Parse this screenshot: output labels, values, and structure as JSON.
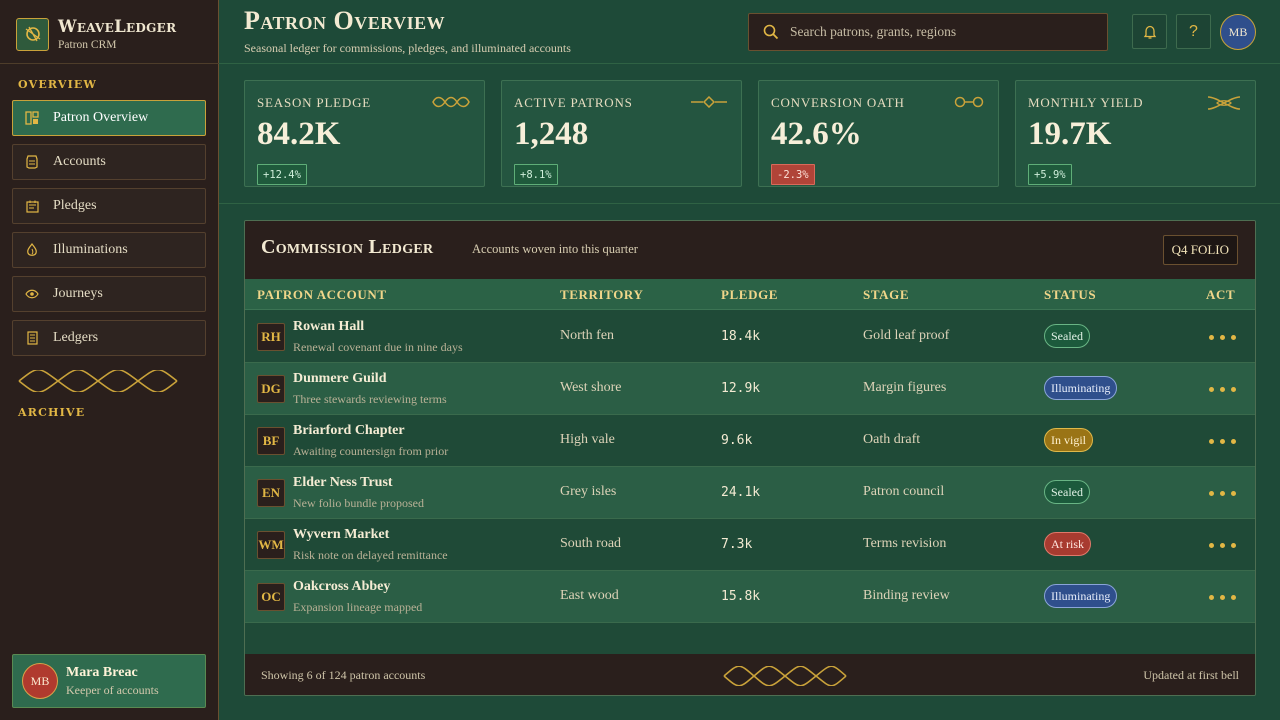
{
  "brand": {
    "name": "WeaveLedger",
    "subtitle": "Patron CRM"
  },
  "sidebar": {
    "overview_label": "OVERVIEW",
    "archive_label": "ARCHIVE",
    "items": [
      {
        "label": "Patron Overview",
        "icon": "overview-icon",
        "active": true
      },
      {
        "label": "Accounts",
        "icon": "accounts-icon"
      },
      {
        "label": "Pledges",
        "icon": "pledges-icon"
      },
      {
        "label": "Illuminations",
        "icon": "flame-icon"
      },
      {
        "label": "Journeys",
        "icon": "eye-icon"
      },
      {
        "label": "Ledgers",
        "icon": "ledger-icon"
      }
    ]
  },
  "user": {
    "initials": "MB",
    "name": "Mara Breac",
    "role": "Keeper of accounts"
  },
  "header": {
    "title": "Patron Overview",
    "subtitle": "Seasonal ledger for commissions, pledges, and illuminated accounts",
    "search_placeholder": "Search patrons, grants, regions",
    "avatar_initials": "MB"
  },
  "kpis": [
    {
      "label": "SEASON PLEDGE",
      "value": "84.2K",
      "delta": "+12.4%",
      "trend": "up"
    },
    {
      "label": "ACTIVE PATRONS",
      "value": "1,248",
      "delta": "+8.1%",
      "trend": "up"
    },
    {
      "label": "CONVERSION OATH",
      "value": "42.6%",
      "delta": "-2.3%",
      "trend": "down"
    },
    {
      "label": "MONTHLY YIELD",
      "value": "19.7K",
      "delta": "+5.9%",
      "trend": "up"
    }
  ],
  "ledger": {
    "title": "Commission Ledger",
    "subtitle": "Accounts woven into this quarter",
    "folio_button": "Q4 FOLIO",
    "columns": [
      "PATRON ACCOUNT",
      "TERRITORY",
      "PLEDGE",
      "STAGE",
      "STATUS",
      "ACT"
    ],
    "rows": [
      {
        "initials": "RH",
        "name": "Rowan Hall",
        "note": "Renewal covenant due in nine days",
        "territory": "North fen",
        "pledge": "18.4k",
        "stage": "Gold leaf proof",
        "status": "Sealed"
      },
      {
        "initials": "DG",
        "name": "Dunmere Guild",
        "note": "Three stewards reviewing terms",
        "territory": "West shore",
        "pledge": "12.9k",
        "stage": "Margin figures",
        "status": "Illuminating"
      },
      {
        "initials": "BF",
        "name": "Briarford Chapter",
        "note": "Awaiting countersign from prior",
        "territory": "High vale",
        "pledge": "9.6k",
        "stage": "Oath draft",
        "status": "In vigil"
      },
      {
        "initials": "EN",
        "name": "Elder Ness Trust",
        "note": "New folio bundle proposed",
        "territory": "Grey isles",
        "pledge": "24.1k",
        "stage": "Patron council",
        "status": "Sealed"
      },
      {
        "initials": "WM",
        "name": "Wyvern Market",
        "note": "Risk note on delayed remittance",
        "territory": "South road",
        "pledge": "7.3k",
        "stage": "Terms revision",
        "status": "At risk"
      },
      {
        "initials": "OC",
        "name": "Oakcross Abbey",
        "note": "Expansion lineage mapped",
        "territory": "East wood",
        "pledge": "15.8k",
        "stage": "Binding review",
        "status": "Illuminating"
      }
    ],
    "footer_left": "Showing 6 of 124 patron accounts",
    "footer_right": "Updated at first bell"
  },
  "colors": {
    "gold": "#e2b745",
    "forest": "#1e4a38",
    "umber": "#2a1f1c",
    "sealed": "#1c5a3c",
    "illuminating": "#2f4f8c",
    "vigil": "#9a7415",
    "risk": "#a83b30"
  }
}
